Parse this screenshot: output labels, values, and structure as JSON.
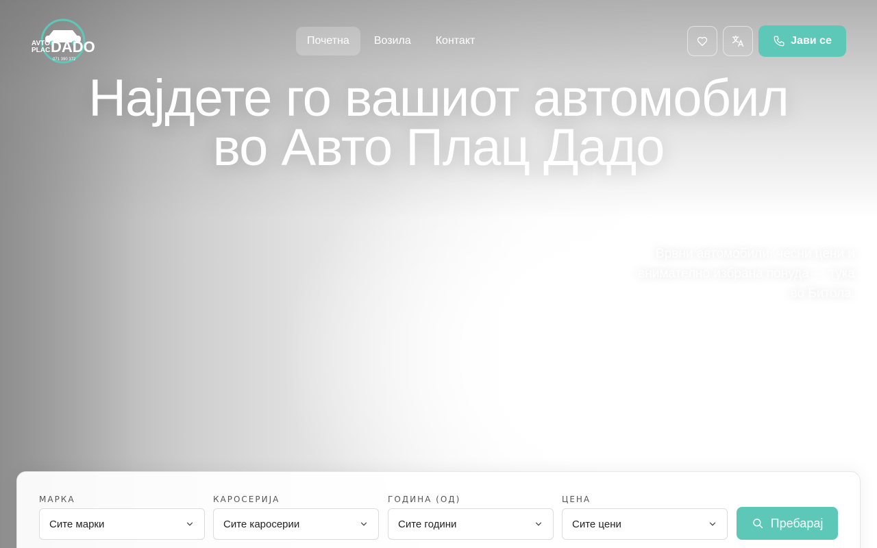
{
  "header": {
    "logo_text_top": "AVTO",
    "logo_text_mid": "PLAC",
    "logo_brand": "DADO",
    "logo_phone": "071 390 372",
    "nav": [
      {
        "label": "Почетна",
        "active": true
      },
      {
        "label": "Возила",
        "active": false
      },
      {
        "label": "Контакт",
        "active": false
      }
    ],
    "favorites_icon": "heart-icon",
    "language_icon": "translate-icon",
    "call_label": "Јави се",
    "call_icon": "phone-icon"
  },
  "hero": {
    "headline_line1": "Најдете го вашиот автомобил",
    "headline_line2": "во Авто Плац Дадо",
    "tagline": "Врвни автомобили, чесни цени и внимателно избрана понуда — тука во Битола."
  },
  "search": {
    "fields": [
      {
        "label": "МАРКА",
        "value": "Сите марки"
      },
      {
        "label": "КАРОСЕРИЈА",
        "value": "Сите каросерии"
      },
      {
        "label": "ГОДИНА (ОД)",
        "value": "Сите години"
      },
      {
        "label": "ЦЕНА",
        "value": "Сите цени"
      }
    ],
    "button_label": "Пребарај",
    "button_icon": "search-icon"
  },
  "colors": {
    "accent": "#5ec8b8",
    "text_light": "#ffffff"
  }
}
